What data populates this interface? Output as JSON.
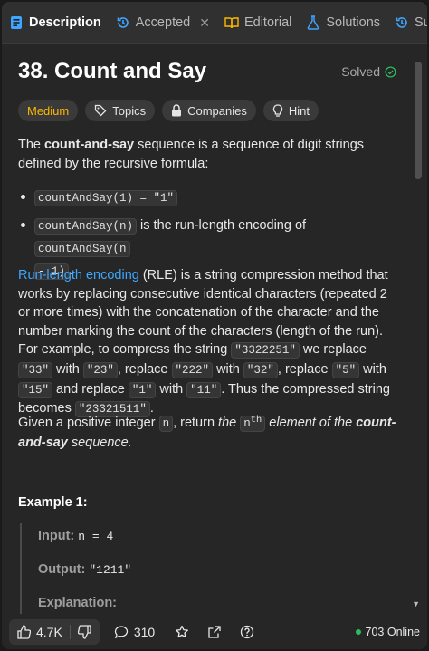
{
  "tabs": [
    {
      "label": "Description",
      "icon": "description-icon",
      "active": true
    },
    {
      "label": "Accepted",
      "icon": "history-icon",
      "active": false,
      "closable": true
    },
    {
      "label": "Editorial",
      "icon": "book-icon",
      "active": false
    },
    {
      "label": "Solutions",
      "icon": "flask-icon",
      "active": false
    },
    {
      "label": "Sul",
      "icon": "history-icon",
      "active": false
    }
  ],
  "problem": {
    "title": "38. Count and Say",
    "status": "Solved"
  },
  "tags": {
    "difficulty": "Medium",
    "topics": "Topics",
    "companies": "Companies",
    "hint": "Hint"
  },
  "description": {
    "intro_pre": "The ",
    "intro_bold": "count-and-say",
    "intro_post": " sequence is a sequence of digit strings defined by the recursive formula:",
    "bullet1_code": "countAndSay(1) = \"1\"",
    "bullet2_code": "countAndSay(n)",
    "bullet2_text": " is the run-length encoding of ",
    "bullet2_code2a": "countAndSay(n",
    "bullet2_code2b": "- 1)",
    "bullet2_end": ".",
    "rle_link": "Run-length encoding",
    "rle_text1": " (RLE) is a string compression method that works by replacing consecutive identical characters (repeated 2 or more times) with the concatenation of the character and the number marking the count of the characters (length of the run). For example, to compress the string ",
    "rle_c1": "\"3322251\"",
    "rle_t2": " we replace ",
    "rle_c2": "\"33\"",
    "rle_t3": " with ",
    "rle_c3": "\"23\"",
    "rle_t4": ", replace ",
    "rle_c4": "\"222\"",
    "rle_t5": " with ",
    "rle_c5": "\"32\"",
    "rle_t6": ", replace ",
    "rle_c6": "\"5\"",
    "rle_t7": " with ",
    "rle_c7": "\"15\"",
    "rle_t8": " and replace ",
    "rle_c8": "\"1\"",
    "rle_t9": " with ",
    "rle_c9": "\"11\"",
    "rle_t10": ". Thus the compressed string becomes ",
    "rle_c10": "\"23321511\"",
    "rle_t11": ".",
    "given_pre": "Given a positive integer ",
    "given_code": "n",
    "given_mid": ", return ",
    "given_the": "the ",
    "given_sup_n": "n",
    "given_sup": "th",
    "given_it": " element of the ",
    "given_bold": "count-and-say",
    "given_end": " sequence."
  },
  "example": {
    "heading": "Example 1:",
    "input_label": "Input:",
    "input_value": "n = 4",
    "output_label": "Output:",
    "output_value": "\"1211\"",
    "explanation_label": "Explanation:"
  },
  "bottom": {
    "likes": "4.7K",
    "comments": "310",
    "online": "703 Online"
  },
  "colors": {
    "medium": "#ffb800",
    "solved": "#2cbb5d",
    "link": "#3ea6ff"
  }
}
